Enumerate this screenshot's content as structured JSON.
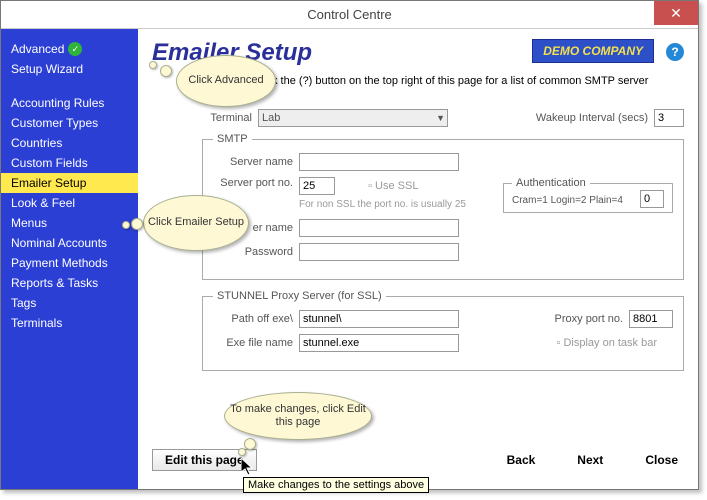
{
  "window": {
    "title": "Control Centre"
  },
  "badge": "DEMO COMPANY",
  "sidebar": {
    "top": [
      {
        "label": "Advanced",
        "check": true
      },
      {
        "label": "Setup Wizard"
      }
    ],
    "items": [
      {
        "label": "Accounting Rules"
      },
      {
        "label": "Customer Types"
      },
      {
        "label": "Countries"
      },
      {
        "label": "Custom Fields"
      },
      {
        "label": "Emailer Setup",
        "selected": true
      },
      {
        "label": "Look & Feel"
      },
      {
        "label": "Menus"
      },
      {
        "label": "Nominal Accounts"
      },
      {
        "label": "Payment Methods"
      },
      {
        "label": "Reports & Tasks"
      },
      {
        "label": "Tags"
      },
      {
        "label": "Terminals"
      }
    ]
  },
  "page": {
    "title": "Emailer Setup",
    "hint": "k the (?) button on the top right of this page for a list of common SMTP server"
  },
  "form": {
    "terminal_label": "Terminal",
    "terminal_value": "Lab",
    "wakeup_label": "Wakeup Interval (secs)",
    "wakeup_value": "3",
    "smtp": {
      "legend": "SMTP",
      "server_name_label": "Server name",
      "server_name_value": "",
      "server_port_label": "Server port no.",
      "server_port_value": "25",
      "use_ssl_label": "Use SSL",
      "ssl_note": "For non SSL the port no. is usually 25",
      "user_name_label": "er name",
      "user_name_value": "",
      "password_label": "Password",
      "password_value": "",
      "auth_legend": "Authentication",
      "auth_label": "Cram=1 Login=2 Plain=4",
      "auth_value": "0"
    },
    "stunnel": {
      "legend": "STUNNEL Proxy Server (for SSL)",
      "path_label": "Path off exe\\",
      "path_value": "stunnel\\",
      "exe_label": "Exe file name",
      "exe_value": "stunnel.exe",
      "proxy_port_label": "Proxy port no.",
      "proxy_port_value": "8801",
      "display_taskbar_label": "Display on task bar"
    }
  },
  "footer": {
    "edit": "Edit this page",
    "back": "Back",
    "next": "Next",
    "close": "Close"
  },
  "tooltip": "Make changes to the settings above",
  "callouts": {
    "c1": "Click Advanced",
    "c2": "Click Emailer Setup",
    "c3": "To make changes, click Edit this page"
  }
}
